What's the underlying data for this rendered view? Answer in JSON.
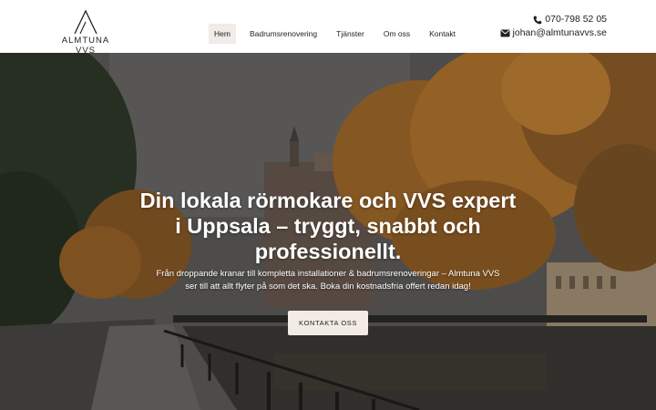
{
  "brand": {
    "name": "ALMTUNA VVS",
    "logo_letter": "A"
  },
  "nav": {
    "items": [
      {
        "label": "Hem",
        "active": true
      },
      {
        "label": "Badrumsrenovering",
        "active": false
      },
      {
        "label": "Tjänster",
        "active": false
      },
      {
        "label": "Om oss",
        "active": false
      },
      {
        "label": "Kontakt",
        "active": false
      }
    ]
  },
  "contact": {
    "phone": "070-798 52 05",
    "phone_icon": "phone-icon",
    "email": "johan@almtunavvs.se",
    "email_icon": "envelope-icon"
  },
  "hero": {
    "title": "Din lokala rörmokare och VVS expert i Uppsala – tryggt, snabbt och professionellt.",
    "subtitle": "Från droppande kranar till kompletta installationer & badrumsrenoveringar – Almtuna VVS ser till att allt flyter på som det ska. Boka din kostnadsfria offert redan idag!",
    "cta_label": "KONTAKTA OSS",
    "background": "autumn-river-city-photo"
  },
  "colors": {
    "header_bg": "#ffffff",
    "active_nav_bg": "#f1ece7",
    "cta_bg": "#f3ece5",
    "text": "#222222",
    "hero_text": "#ffffff"
  }
}
